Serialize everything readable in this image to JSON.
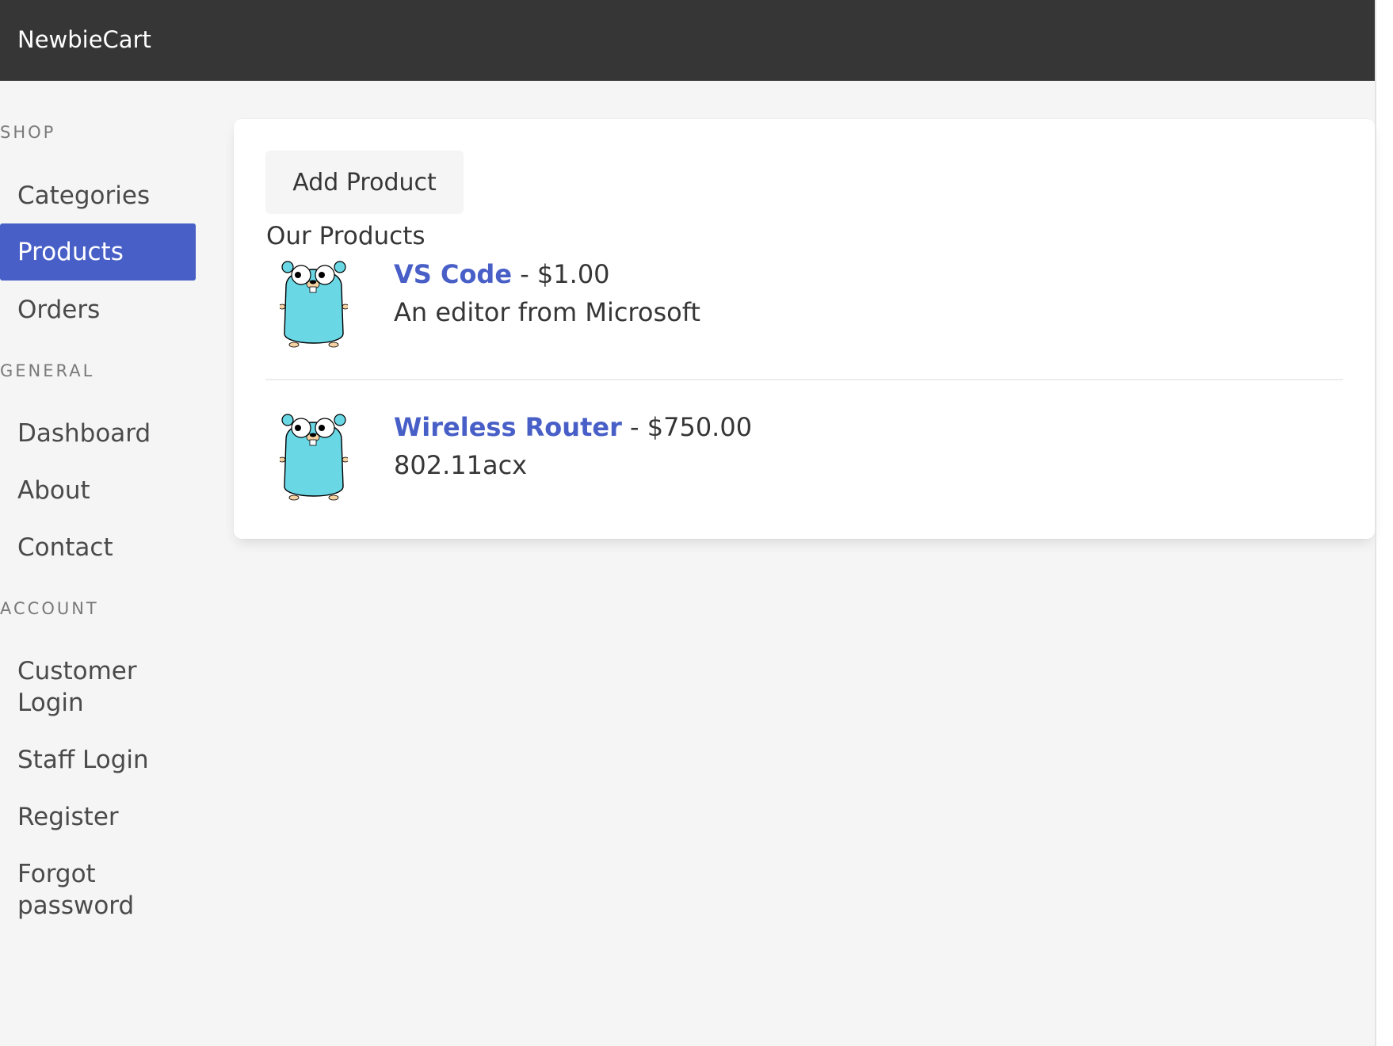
{
  "navbar": {
    "brand": "NewbieCart"
  },
  "sidebar": {
    "sections": [
      {
        "label": "SHOP",
        "items": [
          {
            "label": "Categories",
            "active": false
          },
          {
            "label": "Products",
            "active": true
          },
          {
            "label": "Orders",
            "active": false
          }
        ]
      },
      {
        "label": "GENERAL",
        "items": [
          {
            "label": "Dashboard",
            "active": false
          },
          {
            "label": "About",
            "active": false
          },
          {
            "label": "Contact",
            "active": false
          }
        ]
      },
      {
        "label": "ACCOUNT",
        "items": [
          {
            "label": "Customer Login",
            "active": false
          },
          {
            "label": "Staff Login",
            "active": false
          },
          {
            "label": "Register",
            "active": false
          },
          {
            "label": "Forgot password",
            "active": false
          }
        ]
      }
    ]
  },
  "main": {
    "add_button_label": "Add Product",
    "section_title": "Our Products",
    "products": [
      {
        "name": "VS Code",
        "price_separator": " - ",
        "price": "$1.00",
        "description": "An editor from Microsoft",
        "image_icon": "gopher-mascot-icon"
      },
      {
        "name": "Wireless Router",
        "price_separator": " - ",
        "price": "$750.00",
        "description": "802.11acx",
        "image_icon": "gopher-mascot-icon"
      }
    ]
  },
  "colors": {
    "navbar_bg": "#363636",
    "accent": "#485fc7",
    "page_bg": "#f5f5f5",
    "card_bg": "#ffffff"
  }
}
